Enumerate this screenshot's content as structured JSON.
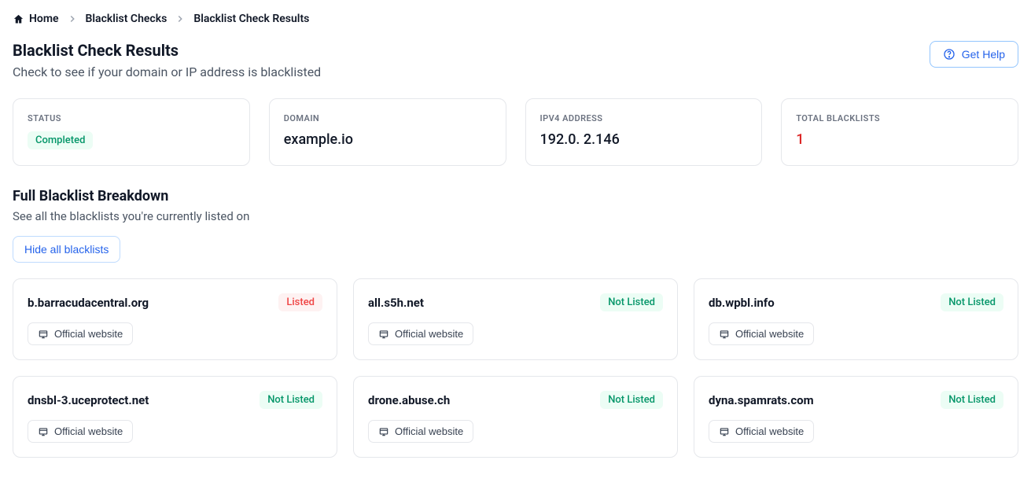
{
  "breadcrumb": {
    "home": "Home",
    "checks": "Blacklist Checks",
    "results": "Blacklist Check Results"
  },
  "header": {
    "title": "Blacklist Check Results",
    "subtitle": "Check to see if your domain or IP address is blacklisted",
    "help_label": "Get Help"
  },
  "stats": {
    "status_label": "STATUS",
    "status_value": "Completed",
    "domain_label": "DOMAIN",
    "domain_value": "example.io",
    "ip_label": "IPV4 ADDRESS",
    "ip_value": "192.0. 2.146",
    "total_label": "TOTAL BLACKLISTS",
    "total_value": "1"
  },
  "breakdown": {
    "title": "Full Blacklist Breakdown",
    "subtitle": "See all the blacklists you're currently listed on",
    "toggle_label": "Hide all blacklists"
  },
  "labels": {
    "official_website": "Official website",
    "listed": "Listed",
    "not_listed": "Not Listed"
  },
  "blacklists": [
    {
      "name": "b.barracudacentral.org",
      "listed": true
    },
    {
      "name": "all.s5h.net",
      "listed": false
    },
    {
      "name": "db.wpbl.info",
      "listed": false
    },
    {
      "name": "dnsbl-3.uceprotect.net",
      "listed": false
    },
    {
      "name": "drone.abuse.ch",
      "listed": false
    },
    {
      "name": "dyna.spamrats.com",
      "listed": false
    }
  ]
}
